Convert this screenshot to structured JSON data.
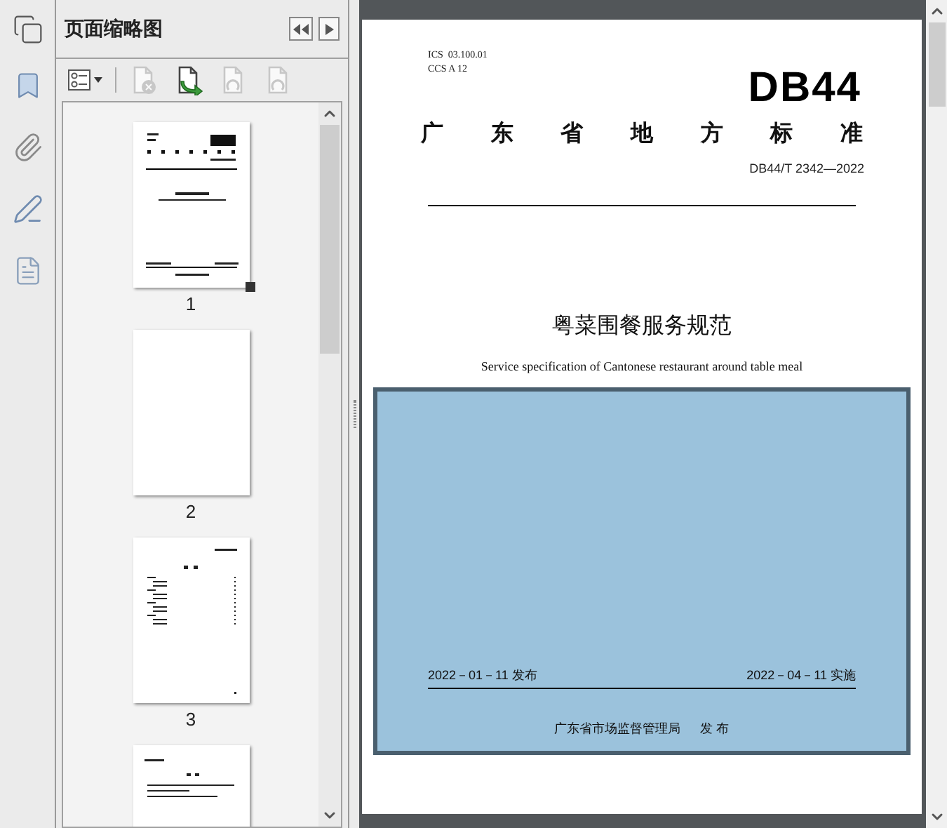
{
  "panel": {
    "title": "页面缩略图"
  },
  "toolbar": [
    {
      "kind": "options",
      "disabled": false
    },
    {
      "kind": "delete",
      "disabled": true
    },
    {
      "kind": "insert",
      "disabled": false
    },
    {
      "kind": "rotate-left",
      "disabled": true
    },
    {
      "kind": "rotate-right",
      "disabled": true
    }
  ],
  "thumbnails": [
    {
      "label": "1",
      "kind": "cover",
      "current": true
    },
    {
      "label": "2",
      "kind": "blank",
      "current": false
    },
    {
      "label": "3",
      "kind": "contents",
      "current": false
    },
    {
      "kind": "text"
    }
  ],
  "document": {
    "ics": "ICS  03.100.01",
    "ccs": "CCS A 12",
    "logo": "DB44",
    "heading": [
      "广",
      "东",
      "省",
      "地",
      "方",
      "标",
      "准"
    ],
    "number": "DB44/T 2342—2022",
    "title": "粤菜围餐服务规范",
    "subtitle": "Service specification of Cantonese restaurant around table meal",
    "highlighted": true,
    "issue_date": "2022－01－11 发布",
    "effective_date": "2022－04－11 实施",
    "publisher": "广东省市场监督管理局",
    "publish_label": "发 布"
  }
}
